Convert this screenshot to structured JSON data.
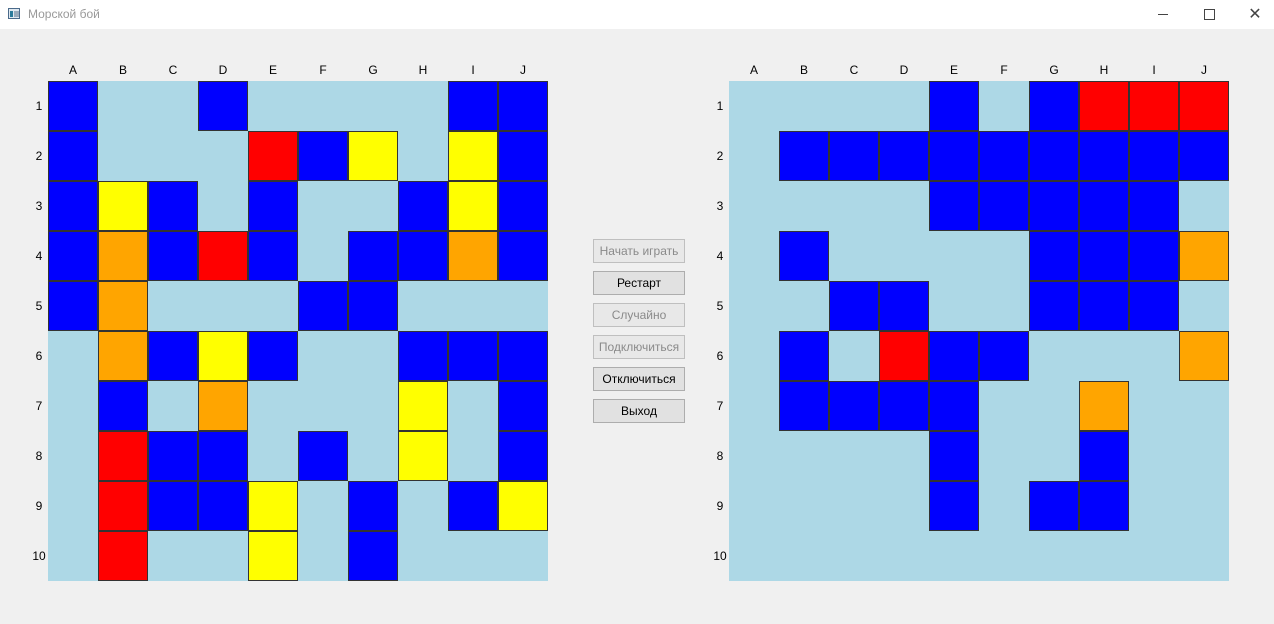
{
  "window": {
    "title": "Морской бой",
    "minimize_icon": "minimize-icon",
    "maximize_icon": "maximize-icon",
    "close_icon": "close-icon",
    "close_glyph": "✕"
  },
  "columns": [
    "A",
    "B",
    "C",
    "D",
    "E",
    "F",
    "G",
    "H",
    "I",
    "J"
  ],
  "rows": [
    "1",
    "2",
    "3",
    "4",
    "5",
    "6",
    "7",
    "8",
    "9",
    "10"
  ],
  "colors": {
    "water": "#add8e6",
    "ship": "#0000ff",
    "hit": "#ff0000",
    "near": "#ffff00",
    "warn": "#ffa500"
  },
  "legend_codes": {
    "0": "water",
    "1": "ship",
    "2": "hit",
    "3": "near",
    "4": "warn"
  },
  "left_board": [
    [
      1,
      0,
      0,
      1,
      0,
      0,
      0,
      0,
      1,
      1
    ],
    [
      1,
      0,
      0,
      0,
      2,
      1,
      3,
      0,
      3,
      1
    ],
    [
      1,
      3,
      1,
      0,
      1,
      0,
      0,
      1,
      3,
      1
    ],
    [
      1,
      4,
      1,
      2,
      1,
      0,
      1,
      1,
      4,
      1
    ],
    [
      1,
      4,
      0,
      0,
      0,
      1,
      1,
      0,
      0,
      0
    ],
    [
      0,
      4,
      1,
      3,
      1,
      0,
      0,
      1,
      1,
      1
    ],
    [
      0,
      1,
      0,
      4,
      0,
      0,
      0,
      3,
      0,
      1
    ],
    [
      0,
      2,
      1,
      1,
      0,
      1,
      0,
      3,
      0,
      1
    ],
    [
      0,
      2,
      1,
      1,
      3,
      0,
      1,
      0,
      1,
      3
    ],
    [
      0,
      2,
      0,
      0,
      3,
      0,
      1,
      0,
      0,
      0
    ]
  ],
  "right_board": [
    [
      0,
      0,
      0,
      0,
      1,
      0,
      1,
      2,
      2,
      2
    ],
    [
      0,
      1,
      1,
      1,
      1,
      1,
      1,
      1,
      1,
      1
    ],
    [
      0,
      0,
      0,
      0,
      1,
      1,
      1,
      1,
      1,
      0
    ],
    [
      0,
      1,
      0,
      0,
      0,
      0,
      1,
      1,
      1,
      4
    ],
    [
      0,
      0,
      1,
      1,
      0,
      0,
      1,
      1,
      1,
      0
    ],
    [
      0,
      1,
      0,
      2,
      1,
      1,
      0,
      0,
      0,
      4
    ],
    [
      0,
      1,
      1,
      1,
      1,
      0,
      0,
      4,
      0,
      0
    ],
    [
      0,
      0,
      0,
      0,
      1,
      0,
      0,
      1,
      0,
      0
    ],
    [
      0,
      0,
      0,
      0,
      1,
      0,
      1,
      1,
      0,
      0
    ],
    [
      0,
      0,
      0,
      0,
      0,
      0,
      0,
      0,
      0,
      0
    ]
  ],
  "controls": {
    "start": "Начать играть",
    "restart": "Рестарт",
    "random": "Случайно",
    "connect": "Подключиться",
    "disconnect": "Отключиться",
    "exit": "Выход"
  }
}
